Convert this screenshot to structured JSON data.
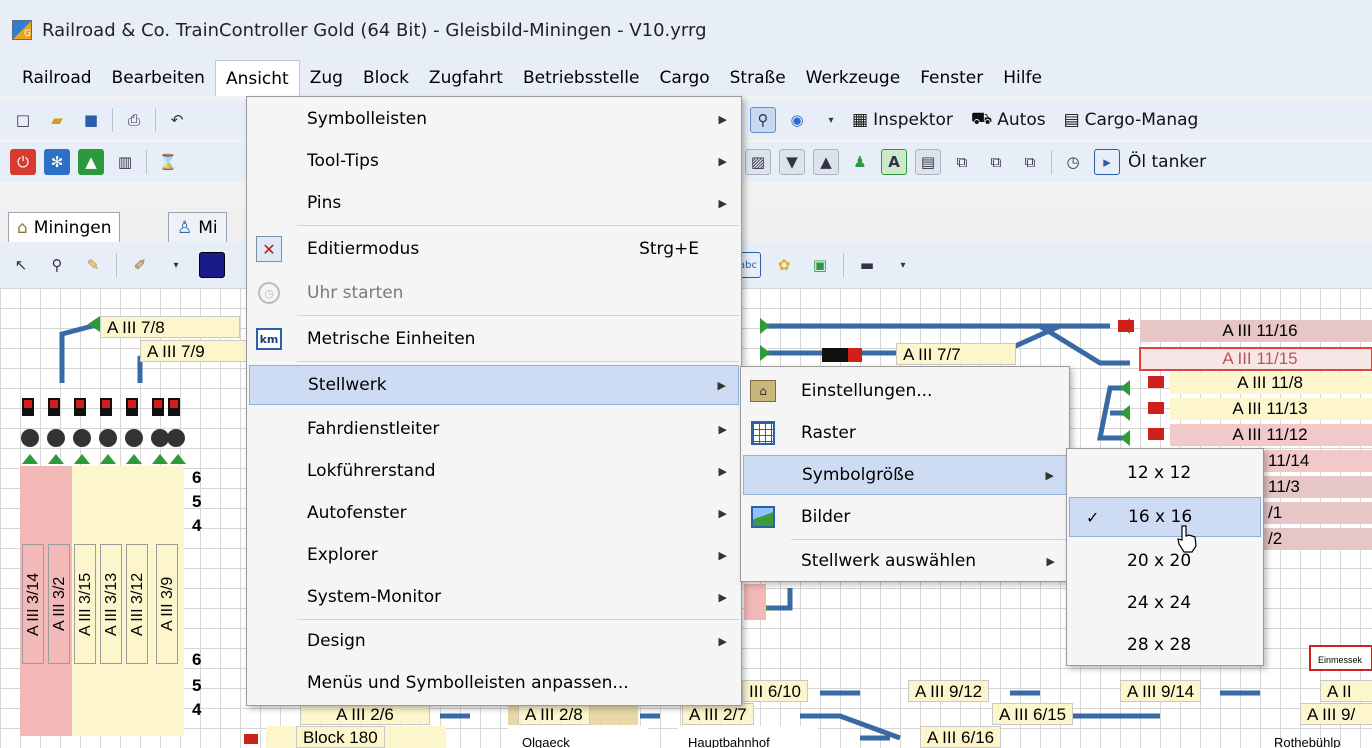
{
  "window": {
    "title": "Railroad & Co. TrainController Gold (64 Bit) - Gleisbild-Miningen - V10.yrrg"
  },
  "menubar": {
    "items": [
      {
        "label": "Railroad"
      },
      {
        "label": "Bearbeiten"
      },
      {
        "label": "Ansicht"
      },
      {
        "label": "Zug"
      },
      {
        "label": "Block"
      },
      {
        "label": "Zugfahrt"
      },
      {
        "label": "Betriebsstelle"
      },
      {
        "label": "Cargo"
      },
      {
        "label": "Straße"
      },
      {
        "label": "Werkzeuge"
      },
      {
        "label": "Fenster"
      },
      {
        "label": "Hilfe"
      }
    ],
    "active": "Ansicht"
  },
  "toolbar": {
    "inspektor": "Inspektor",
    "autos": "Autos",
    "cargo": "Cargo-Manag",
    "oeltanker": "Öl tanker"
  },
  "tabs": [
    {
      "label": "Miningen"
    },
    {
      "label": "Mi"
    }
  ],
  "menu_ansicht": {
    "items": [
      {
        "label": "Symbolleisten",
        "submenu": true
      },
      {
        "label": "Tool-Tips",
        "submenu": true
      },
      {
        "label": "Pins",
        "submenu": true
      },
      {
        "label": "Editiermodus",
        "shortcut": "Strg+E",
        "icon": "tools-icon"
      },
      {
        "label": "Uhr starten",
        "disabled": true,
        "icon": "clock-icon"
      },
      {
        "label": "Metrische Einheiten",
        "icon": "km-icon"
      },
      {
        "label": "Stellwerk",
        "submenu": true,
        "highlighted": true
      },
      {
        "label": "Fahrdienstleiter",
        "submenu": true
      },
      {
        "label": "Lokführerstand",
        "submenu": true
      },
      {
        "label": "Autofenster",
        "submenu": true
      },
      {
        "label": "Explorer",
        "submenu": true
      },
      {
        "label": "System-Monitor",
        "submenu": true
      },
      {
        "label": "Design",
        "submenu": true
      },
      {
        "label": "Menüs und Symbolleisten anpassen..."
      }
    ]
  },
  "menu_stellwerk": {
    "items": [
      {
        "label": "Einstellungen...",
        "icon": "settings-icon"
      },
      {
        "label": "Raster",
        "icon": "grid-icon"
      },
      {
        "label": "Symbolgröße",
        "submenu": true,
        "highlighted": true
      },
      {
        "label": "Bilder",
        "icon": "picture-icon"
      },
      {
        "label": "Stellwerk auswählen",
        "submenu": true
      }
    ]
  },
  "menu_symbolgroesse": {
    "items": [
      {
        "label": "12 x 12"
      },
      {
        "label": "16 x 16",
        "checked": true,
        "highlighted": true
      },
      {
        "label": "20 x 20"
      },
      {
        "label": "24 x 24"
      },
      {
        "label": "28 x 28"
      }
    ],
    "check_glyph": "✓"
  },
  "layout_labels": {
    "top": [
      "A III 7/8",
      "A III 7/9",
      "A III 11/16",
      "A III 11/15",
      "A III 7/7",
      "A III 11/8",
      "A III 11/13",
      "A III 11/12",
      "11/14",
      "11/3",
      "/1",
      "/2"
    ],
    "vertical": [
      "A III 3/14",
      "A III 3/2",
      "A III 3/15",
      "A III 3/13",
      "A III 3/12",
      "A III 3/9"
    ],
    "bottom": [
      "III 6/10",
      "A III 9/12",
      "A III 9/14",
      "A II",
      "A III 2/6",
      "A III 2/8",
      "A III 2/7",
      "A III 6/15",
      "A III 9/",
      "Block 180",
      "A III 6/16"
    ],
    "places": [
      "Olgaeck",
      "Hauptbahnhof",
      "Rothebühlp",
      "Einmessek"
    ],
    "numbers": [
      "6",
      "5",
      "4",
      "6",
      "5",
      "4"
    ]
  },
  "colors": {
    "menu_highlight": "#cddcf2",
    "track_blue": "#3a6aa6",
    "signal_red": "#d0201c",
    "signal_green": "#2e9b3a",
    "block_yellow": "#fdf6cc",
    "block_pink": "#f3b8b8"
  }
}
